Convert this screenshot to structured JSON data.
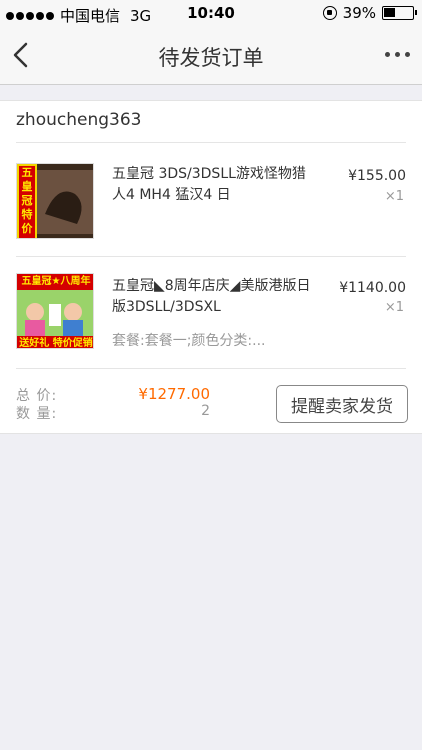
{
  "status_bar": {
    "carrier": "中国电信",
    "network": "3G",
    "time": "10:40",
    "battery": "39%",
    "battery_level": 0.39
  },
  "navbar": {
    "title": "待发货订单"
  },
  "order": {
    "shop_name": "zhoucheng363",
    "items": [
      {
        "title": "五皇冠 3DS/3DSLL游戏怪物猎人4 MH4 猛汉4 日",
        "spec": "",
        "price": "¥155.00",
        "qty": "×1",
        "thumb_text": "五皇冠特价"
      },
      {
        "title": "五皇冠◣8周年店庆◢美版港版日版3DSLL/3DSXL",
        "spec": "套餐:套餐一;颜色分类:...",
        "price": "¥1140.00",
        "qty": "×1",
        "thumb_text_top": "五皇冠★八周年",
        "thumb_text_bottom": "送好礼 特价促销"
      }
    ],
    "total_label": "总 价:",
    "total_value": "¥1277.00",
    "count_label": "数 量:",
    "count_value": "2",
    "remind_button": "提醒卖家发货"
  },
  "colors": {
    "accent": "#ff6a00",
    "background": "#efeff4"
  }
}
